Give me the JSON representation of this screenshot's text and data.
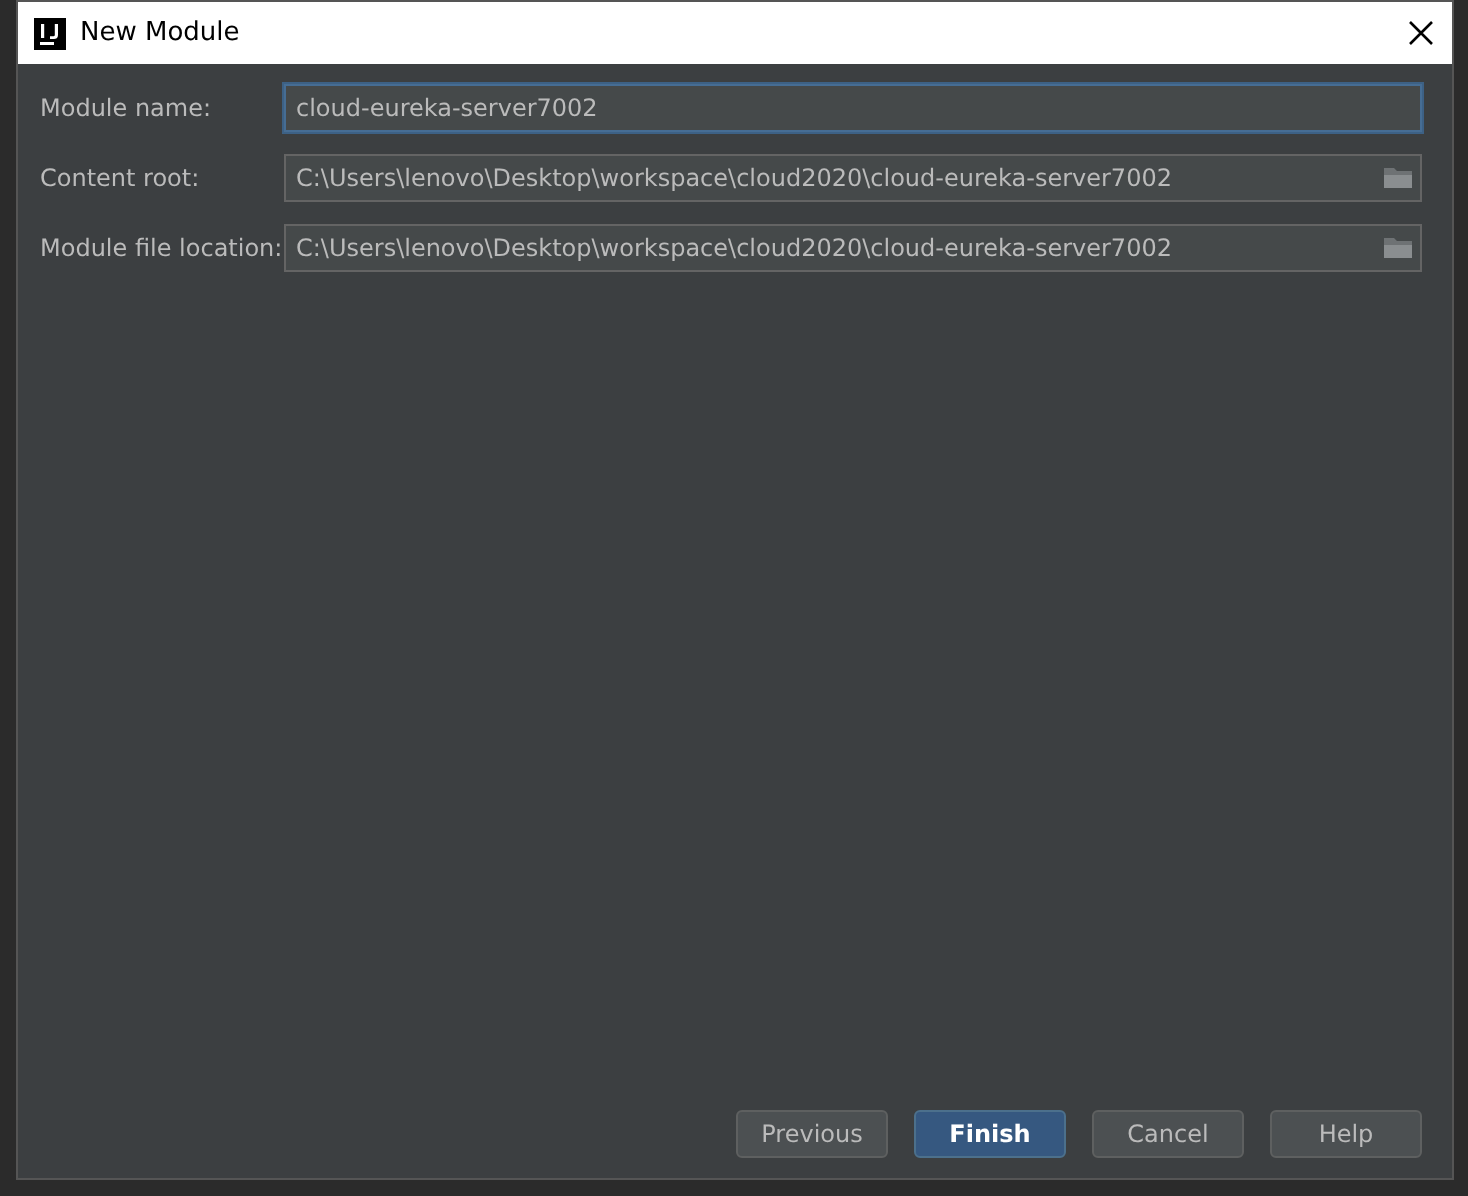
{
  "window": {
    "title": "New Module"
  },
  "fields": [
    {
      "label": "Module name:",
      "value": "cloud-eureka-server7002",
      "focused": true,
      "browse": false
    },
    {
      "label": "Content root:",
      "value": "C:\\Users\\lenovo\\Desktop\\workspace\\cloud2020\\cloud-eureka-server7002",
      "focused": false,
      "browse": true
    },
    {
      "label": "Module file location:",
      "value": "C:\\Users\\lenovo\\Desktop\\workspace\\cloud2020\\cloud-eureka-server7002",
      "focused": false,
      "browse": true
    }
  ],
  "buttons": [
    {
      "label": "Previous",
      "default": false
    },
    {
      "label": "Finish",
      "default": true
    },
    {
      "label": "Cancel",
      "default": false
    },
    {
      "label": "Help",
      "default": false
    }
  ]
}
